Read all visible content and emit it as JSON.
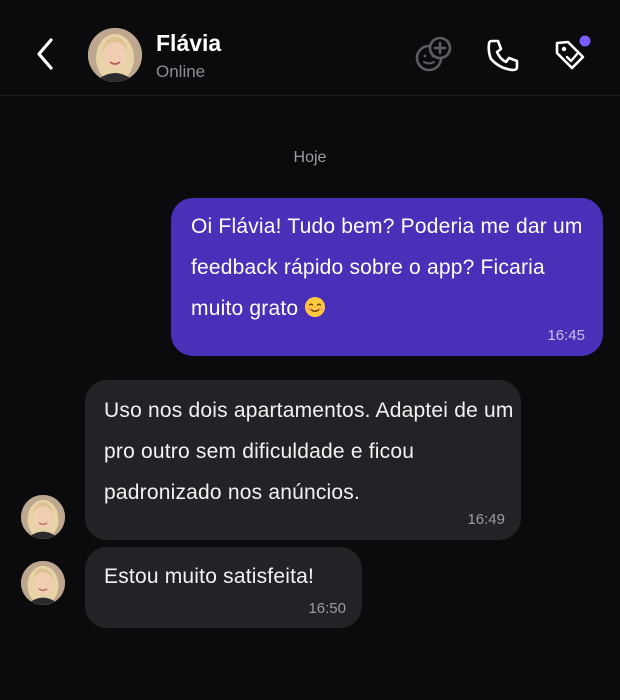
{
  "header": {
    "contact_name": "Flávia",
    "status": "Online",
    "icons": [
      "back-chevron-icon",
      "sticker-add-icon",
      "phone-icon",
      "tag-icon"
    ],
    "notification_dot_color": "#7b5cff"
  },
  "chat": {
    "date_separator": "Hoje",
    "messages": [
      {
        "direction": "outgoing",
        "text": "Oi Flávia! Tudo bem? Poderia me dar um feedback rápido sobre o app? Ficaria muito grato",
        "emoji": "smiling-face-emoji",
        "time": "16:45"
      },
      {
        "direction": "incoming",
        "text": "Uso nos dois apartamentos. Adaptei de um pro outro sem dificuldade e ficou padronizado nos anúncios.",
        "time": "16:49"
      },
      {
        "direction": "incoming",
        "text": "Estou muito satisfeita!",
        "time": "16:50"
      }
    ]
  },
  "colors": {
    "background": "#0b0b0d",
    "outgoing_bubble": "#4a2fb8",
    "incoming_bubble": "#232327",
    "secondary_text": "#8c8c94"
  }
}
